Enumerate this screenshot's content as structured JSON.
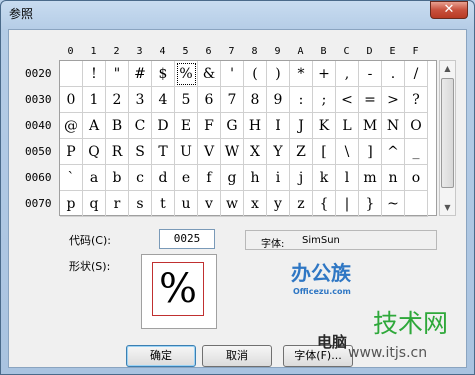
{
  "window": {
    "title": "参照",
    "close_glyph": "✕"
  },
  "grid": {
    "columns": [
      "0",
      "1",
      "2",
      "3",
      "4",
      "5",
      "6",
      "7",
      "8",
      "9",
      "A",
      "B",
      "C",
      "D",
      "E",
      "F"
    ],
    "rows": [
      {
        "label": "0020",
        "chars": [
          " ",
          "!",
          "\"",
          "#",
          "$",
          "%",
          "&",
          "'",
          "(",
          ")",
          "*",
          "+",
          ",",
          "-",
          ".",
          "/"
        ]
      },
      {
        "label": "0030",
        "chars": [
          "0",
          "1",
          "2",
          "3",
          "4",
          "5",
          "6",
          "7",
          "8",
          "9",
          ":",
          ";",
          "<",
          "=",
          ">",
          "?"
        ]
      },
      {
        "label": "0040",
        "chars": [
          "@",
          "A",
          "B",
          "C",
          "D",
          "E",
          "F",
          "G",
          "H",
          "I",
          "J",
          "K",
          "L",
          "M",
          "N",
          "O"
        ]
      },
      {
        "label": "0050",
        "chars": [
          "P",
          "Q",
          "R",
          "S",
          "T",
          "U",
          "V",
          "W",
          "X",
          "Y",
          "Z",
          "[",
          "\\",
          "]",
          "^",
          "_"
        ]
      },
      {
        "label": "0060",
        "chars": [
          "`",
          "a",
          "b",
          "c",
          "d",
          "e",
          "f",
          "g",
          "h",
          "i",
          "j",
          "k",
          "l",
          "m",
          "n",
          "o"
        ]
      },
      {
        "label": "0070",
        "chars": [
          "p",
          "q",
          "r",
          "s",
          "t",
          "u",
          "v",
          "w",
          "x",
          "y",
          "z",
          "{",
          "|",
          "}",
          "~",
          ""
        ]
      }
    ],
    "selected_row": 0,
    "selected_col": 5
  },
  "code": {
    "label": "代码(C):",
    "value": "0025"
  },
  "font": {
    "label": "字体:",
    "value": "SimSun"
  },
  "shape": {
    "label": "形状(S):",
    "glyph": "%"
  },
  "buttons": {
    "ok": "确定",
    "cancel": "取消",
    "font": "字体(F)..."
  },
  "watermark": {
    "brand": "办公族",
    "site": "Officezu.com",
    "category": "技术网",
    "sub": "电脑",
    "url": "www.itjs.cn"
  },
  "colors": {
    "selection_box": "#c03030",
    "window_frame": "#b4cce6"
  }
}
